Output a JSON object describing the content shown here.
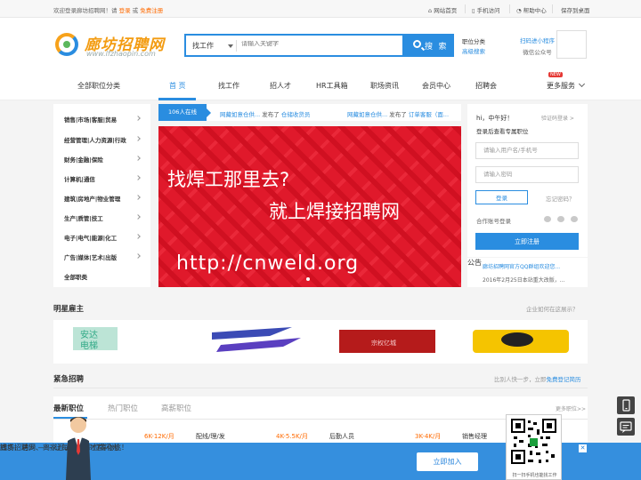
{
  "topbar": {
    "welcome": "欢迎登录廊坊招聘网！请",
    "login": "登录",
    "or": "或",
    "register": "免费注册",
    "links": [
      "网站首页",
      "手机访问",
      "帮助中心",
      "保存到桌面"
    ]
  },
  "header": {
    "logo_cn": "廊坊招聘网",
    "logo_url": "www.lfzhaopin.com",
    "search_type": "找工作",
    "search_placeholder": "请输入关键字",
    "search_button": "搜 索",
    "links": [
      "职位分类",
      "高级搜索"
    ],
    "mini_program": "扫码进小程序",
    "wechat": "微信公众号"
  },
  "nav": {
    "all_categories": "全部职位分类",
    "items": [
      "首 页",
      "找工作",
      "招人才",
      "HR工具箱",
      "职场资讯",
      "会员中心",
      "招聘会",
      "更多服务"
    ],
    "new_badge": "NEW"
  },
  "categories": [
    "销售|市场|客服|贸易",
    "经营管理|人力资源|行政",
    "财务|金融|保险",
    "计算机|通信",
    "建筑|房地产|物业管理",
    "生产|质管|技工",
    "电子|电气|能源|化工",
    "广告|媒体|艺术|出版",
    "全部职类"
  ],
  "ticker": {
    "online": "106人在线",
    "items": [
      {
        "company": "网藏如意仓供...",
        "verb": "发布了",
        "job": "仓储收货员"
      },
      {
        "company": "网藏如意仓供...",
        "verb": "发布了",
        "job": "订单客服（面..."
      }
    ]
  },
  "banner": {
    "line1": "找焊工那里去?",
    "line2": "就上焊接招聘网",
    "url": "http://cnweld.org"
  },
  "login": {
    "greeting": "hi，中午好！",
    "switch": "验证码登录 >",
    "sub": "登录后查看专属职位",
    "user_placeholder": "请输入用户名/手机号",
    "pwd_placeholder": "请输入密码",
    "login_button": "登录",
    "forgot": "忘记密码？",
    "coop": "合作账号登录",
    "register_button": "立即注册"
  },
  "notice": {
    "tag": "公告",
    "items": [
      "廊坊招聘网官方QQ群组欢迎您...",
      "2016年2月25日本站重大改版，..."
    ]
  },
  "star": {
    "title": "明星雇主",
    "hint": "企业如何在这展示？"
  },
  "urgent": {
    "title": "紧急招聘",
    "hint": "比别人快一步，立即",
    "hint_link": "免费登记简历"
  },
  "tabs": {
    "items": [
      "最新职位",
      "热门职位",
      "高薪职位"
    ],
    "more": "更多职位>>"
  },
  "jobs": [
    {
      "title": "",
      "salary": "6K-12K/月"
    },
    {
      "title": "配线/理/发",
      "salary": "4K-5.5K/月"
    },
    {
      "title": "后勤人员",
      "salary": "3K-4K/月"
    },
    {
      "title": "销售经理",
      "salary": ""
    }
  ],
  "bottom_bar": {
    "title": "廊坊招聘网 —— 让每一个人才都闪光",
    "sub": "钱多、活少、离家近，海量职位等你挑！",
    "join": "立即加入",
    "close": "✕",
    "qr_caption": "扫一扫手机也能找工作"
  },
  "colors": {
    "accent": "#2a8de0",
    "orange": "#ff6a00",
    "banner": "#e0192b"
  }
}
